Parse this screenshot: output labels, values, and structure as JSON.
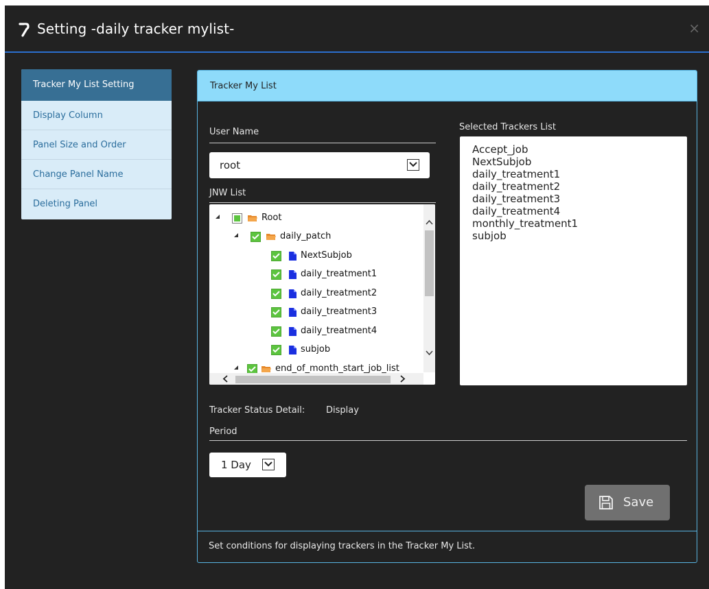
{
  "dialog": {
    "title": "Setting -daily tracker mylist-",
    "close_label": "×",
    "title_icon": "wrench-icon"
  },
  "sidebar": {
    "items": [
      {
        "label": "Tracker My List Setting",
        "active": true
      },
      {
        "label": "Display Column"
      },
      {
        "label": "Panel Size and Order"
      },
      {
        "label": "Change Panel Name"
      },
      {
        "label": "Deleting Panel"
      }
    ]
  },
  "panel": {
    "header": "Tracker My List",
    "user_name_label": "User Name",
    "user_name_value": "root",
    "jnw_list_label": "JNW List",
    "tree": [
      {
        "label": "Root",
        "level": 0,
        "expanded": true,
        "check": "partial",
        "icon": "folder-icon"
      },
      {
        "label": "daily_patch",
        "level": 1,
        "expanded": true,
        "check": "full",
        "icon": "folder-icon"
      },
      {
        "label": "NextSubjob",
        "level": 2,
        "check": "full",
        "icon": "file-icon"
      },
      {
        "label": "daily_treatment1",
        "level": 2,
        "check": "full",
        "icon": "file-icon"
      },
      {
        "label": "daily_treatment2",
        "level": 2,
        "check": "full",
        "icon": "file-icon"
      },
      {
        "label": "daily_treatment3",
        "level": 2,
        "check": "full",
        "icon": "file-icon"
      },
      {
        "label": "daily_treatment4",
        "level": 2,
        "check": "full",
        "icon": "file-icon"
      },
      {
        "label": "subjob",
        "level": 2,
        "check": "full",
        "icon": "file-icon"
      },
      {
        "label": "end_of_month_start_job_list",
        "level": 1,
        "expanded": true,
        "check": "full",
        "icon": "folder-icon"
      }
    ],
    "selected_trackers_label": "Selected Trackers List",
    "selected_trackers": [
      "Accept_job",
      "NextSubjob",
      "daily_treatment1",
      "daily_treatment2",
      "daily_treatment3",
      "daily_treatment4",
      "monthly_treatment1",
      "subjob"
    ],
    "status_detail_label": "Tracker Status Detail:",
    "status_detail_value": "Display",
    "period_label": "Period",
    "period_value": "1 Day",
    "save_label": "Save",
    "footer": "Set conditions for displaying trackers in the Tracker My List."
  },
  "colors": {
    "dialog_bg": "#222222",
    "accent": "#2b6fd0",
    "panel_header": "#8edbfa",
    "sidebar_active": "#376f94",
    "checkbox_green": "#5cc43f"
  }
}
